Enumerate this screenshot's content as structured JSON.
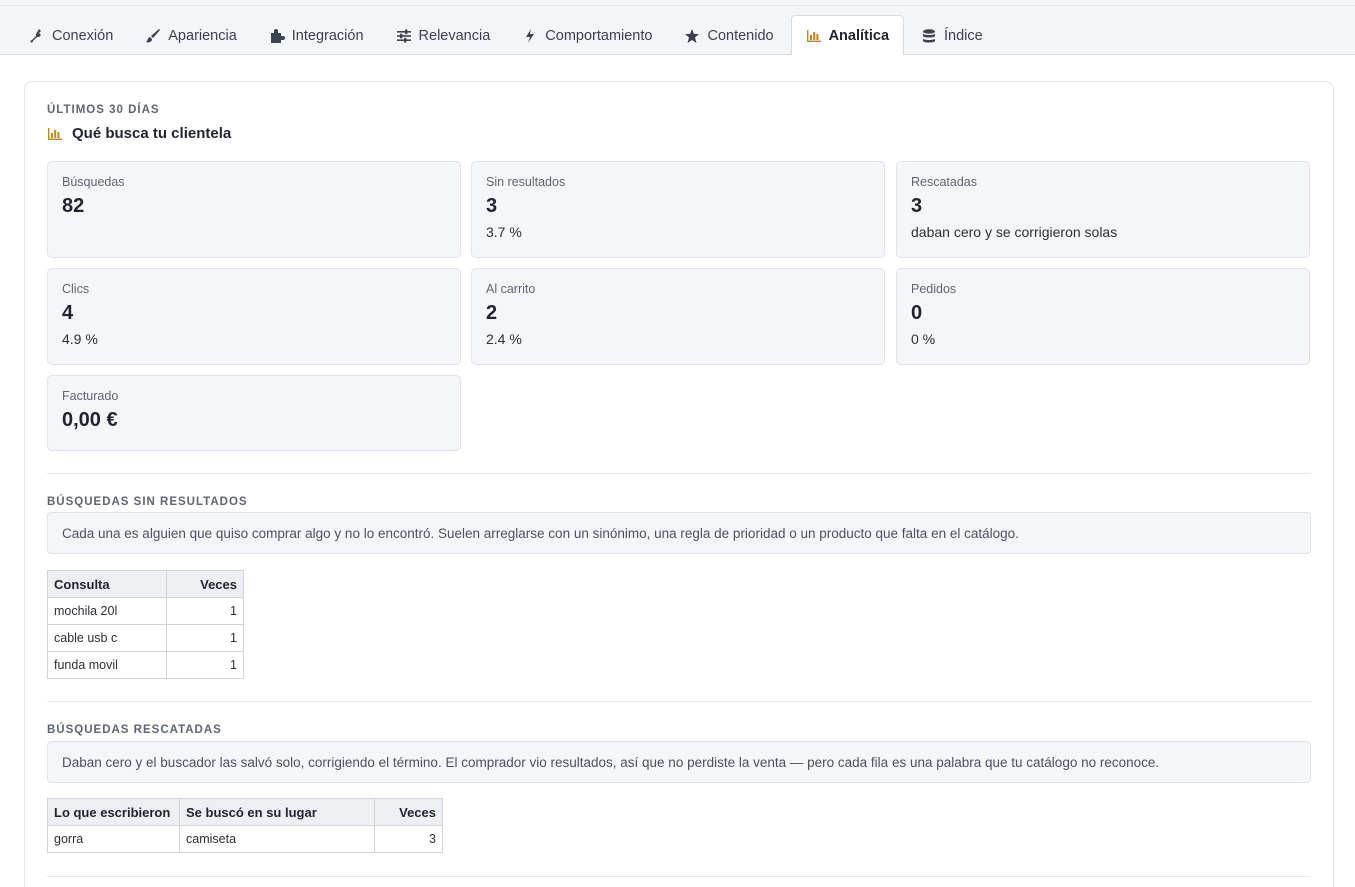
{
  "tabs": [
    {
      "label": "Conexión",
      "icon": "plug-icon"
    },
    {
      "label": "Apariencia",
      "icon": "brush-icon"
    },
    {
      "label": "Integración",
      "icon": "puzzle-icon"
    },
    {
      "label": "Relevancia",
      "icon": "sliders-icon"
    },
    {
      "label": "Comportamiento",
      "icon": "bolt-icon"
    },
    {
      "label": "Contenido",
      "icon": "star-icon"
    },
    {
      "label": "Analítica",
      "icon": "bar-chart-icon",
      "active": true
    },
    {
      "label": "Índice",
      "icon": "database-icon"
    }
  ],
  "summary": {
    "eyebrow": "Últimos 30 días",
    "title": "Qué busca tu clientela",
    "accent_color": "#c8860a",
    "stats": [
      {
        "label": "Búsquedas",
        "value": "82",
        "sub": ""
      },
      {
        "label": "Sin resultados",
        "value": "3",
        "sub": "3.7 %"
      },
      {
        "label": "Rescatadas",
        "value": "3",
        "sub": "daban cero y se corrigieron solas"
      },
      {
        "label": "Clics",
        "value": "4",
        "sub": "4.9 %"
      },
      {
        "label": "Al carrito",
        "value": "2",
        "sub": "2.4 %"
      },
      {
        "label": "Pedidos",
        "value": "0",
        "sub": "0 %"
      },
      {
        "label": "Facturado",
        "value": "0,00 €",
        "sub": ""
      }
    ]
  },
  "no_results": {
    "eyebrow": "Búsquedas sin resultados",
    "note": "Cada una es alguien que quiso comprar algo y no lo encontró. Suelen arreglarse con un sinónimo, una regla de prioridad o un producto que falta en el catálogo.",
    "columns": [
      "Consulta",
      "Veces"
    ],
    "rows": [
      [
        "mochila 20l",
        "1"
      ],
      [
        "cable usb c",
        "1"
      ],
      [
        "funda movil",
        "1"
      ]
    ]
  },
  "rescued": {
    "eyebrow": "Búsquedas rescatadas",
    "note": "Daban cero y el buscador las salvó solo, corrigiendo el término. El comprador vio resultados, así que no perdiste la venta — pero cada fila es una palabra que tu catálogo no reconoce.",
    "columns": [
      "Lo que escribieron",
      "Se buscó en su lugar",
      "Veces"
    ],
    "rows": [
      [
        "gorra",
        "camiseta",
        "3"
      ]
    ]
  }
}
